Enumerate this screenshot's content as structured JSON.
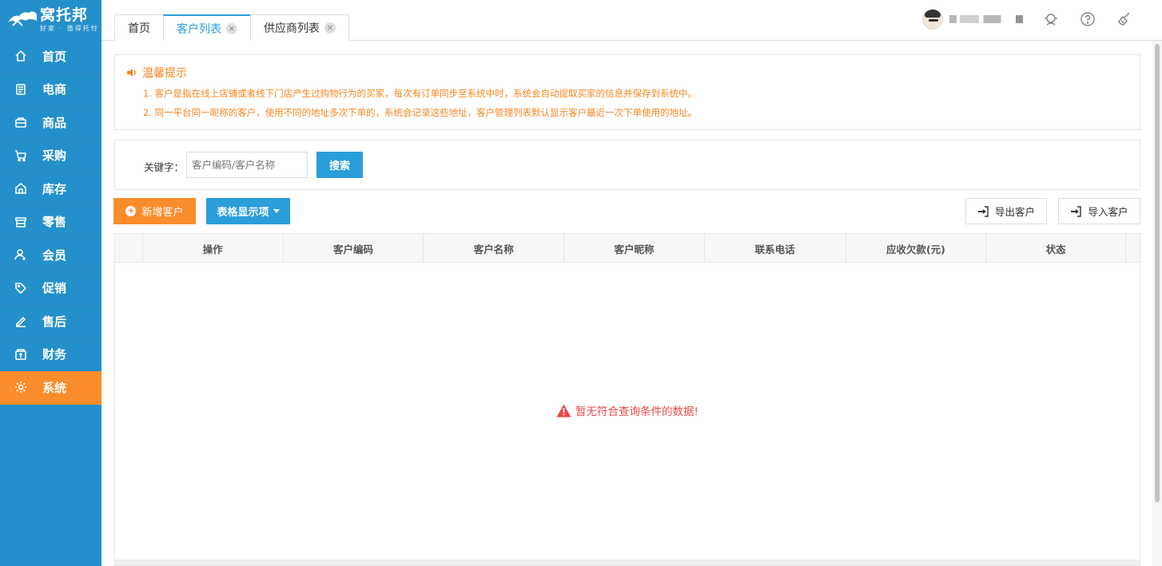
{
  "brand": {
    "name": "窝托邦",
    "tagline": "好家 · 值得托付"
  },
  "sidebar": {
    "items": [
      {
        "label": "首页",
        "icon": "home-icon",
        "active": false
      },
      {
        "label": "电商",
        "icon": "ecommerce-icon",
        "active": false
      },
      {
        "label": "商品",
        "icon": "goods-icon",
        "active": false
      },
      {
        "label": "采购",
        "icon": "cart-icon",
        "active": false
      },
      {
        "label": "库存",
        "icon": "warehouse-icon",
        "active": false
      },
      {
        "label": "零售",
        "icon": "retail-icon",
        "active": false
      },
      {
        "label": "会员",
        "icon": "member-icon",
        "active": false
      },
      {
        "label": "促销",
        "icon": "tag-icon",
        "active": false
      },
      {
        "label": "售后",
        "icon": "pen-icon",
        "active": false
      },
      {
        "label": "财务",
        "icon": "finance-icon",
        "active": false
      },
      {
        "label": "系统",
        "icon": "gear-icon",
        "active": true
      }
    ]
  },
  "tabs": [
    {
      "label": "首页",
      "closable": false,
      "active": false
    },
    {
      "label": "客户列表",
      "closable": true,
      "active": true
    },
    {
      "label": "供应商列表",
      "closable": true,
      "active": false
    }
  ],
  "header": {
    "icons": [
      "support-icon",
      "help-icon",
      "broom-icon"
    ]
  },
  "notice": {
    "title": "温馨提示",
    "lines": [
      "1. 客户是指在线上店铺或者线下门店产生过购物行为的买家，每次有订单同步至系统中时，系统会自动提取买家的信息并保存到系统中。",
      "2. 同一平台同一昵称的客户，使用不同的地址多次下单的，系统会记录这些地址，客户管理列表默认显示客户最近一次下单使用的地址。"
    ]
  },
  "search": {
    "label": "关键字：",
    "placeholder": "客户编码/客户名称",
    "button": "搜索"
  },
  "actions": {
    "add": "新增客户",
    "columns": "表格显示项",
    "export": "导出客户",
    "import": "导入客户"
  },
  "table": {
    "columns": [
      "操作",
      "客户编码",
      "客户名称",
      "客户昵称",
      "联系电话",
      "应收欠款(元)",
      "状态"
    ],
    "rows": [],
    "empty_text": "暂无符合查询条件的数据!"
  },
  "colors": {
    "sidebar": "#2490cb",
    "accent_orange": "#fb8c2b",
    "primary_blue": "#2a9ed9",
    "notice_text": "#f5861f",
    "error_red": "#e94848"
  }
}
